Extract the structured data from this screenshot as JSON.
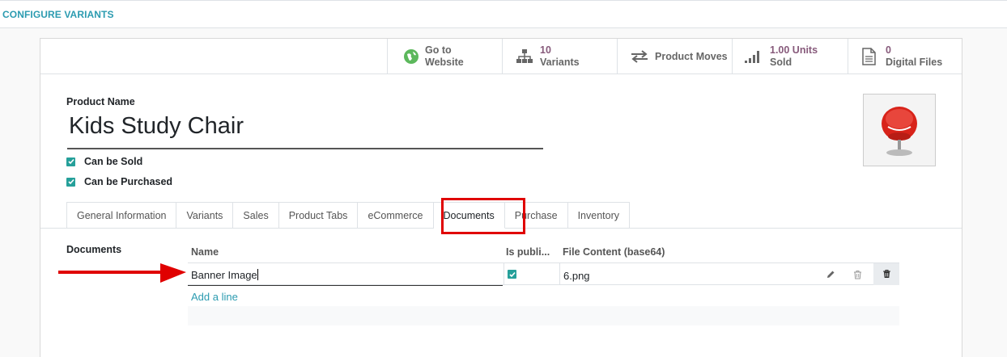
{
  "breadcrumb": {
    "title": "CONFIGURE VARIANTS"
  },
  "smart_buttons": {
    "website": {
      "line1": "Go to",
      "line2": "Website",
      "icon": "globe-icon"
    },
    "variants": {
      "count": "10",
      "label": "Variants",
      "icon": "sitemap-icon"
    },
    "moves": {
      "label": "Product Moves",
      "icon": "exchange-arrows-icon"
    },
    "sold": {
      "count": "1.00 Units",
      "label": "Sold",
      "icon": "signal-bars-icon"
    },
    "files": {
      "count": "0",
      "label": "Digital Files",
      "icon": "file-icon"
    }
  },
  "product": {
    "name_label": "Product Name",
    "name": "Kids Study Chair",
    "can_be_sold": "Can be Sold",
    "can_be_purchased": "Can be Purchased",
    "image": "red-chair-image"
  },
  "tabs": [
    {
      "label": "General Information"
    },
    {
      "label": "Variants"
    },
    {
      "label": "Sales"
    },
    {
      "label": "Product Tabs"
    },
    {
      "label": "eCommerce"
    },
    {
      "label": "Documents",
      "active": true
    },
    {
      "label": "Purchase"
    },
    {
      "label": "Inventory"
    }
  ],
  "documents": {
    "section_label": "Documents",
    "columns": {
      "name": "Name",
      "is_public": "Is publi...",
      "file_content": "File Content (base64)"
    },
    "rows": [
      {
        "name": "Banner Image",
        "is_public": true,
        "file_content": "6.png"
      }
    ],
    "add_line": "Add a line"
  },
  "colors": {
    "accent": "#2b9bb0",
    "stat": "#875a7b",
    "highlight": "#e00000"
  }
}
